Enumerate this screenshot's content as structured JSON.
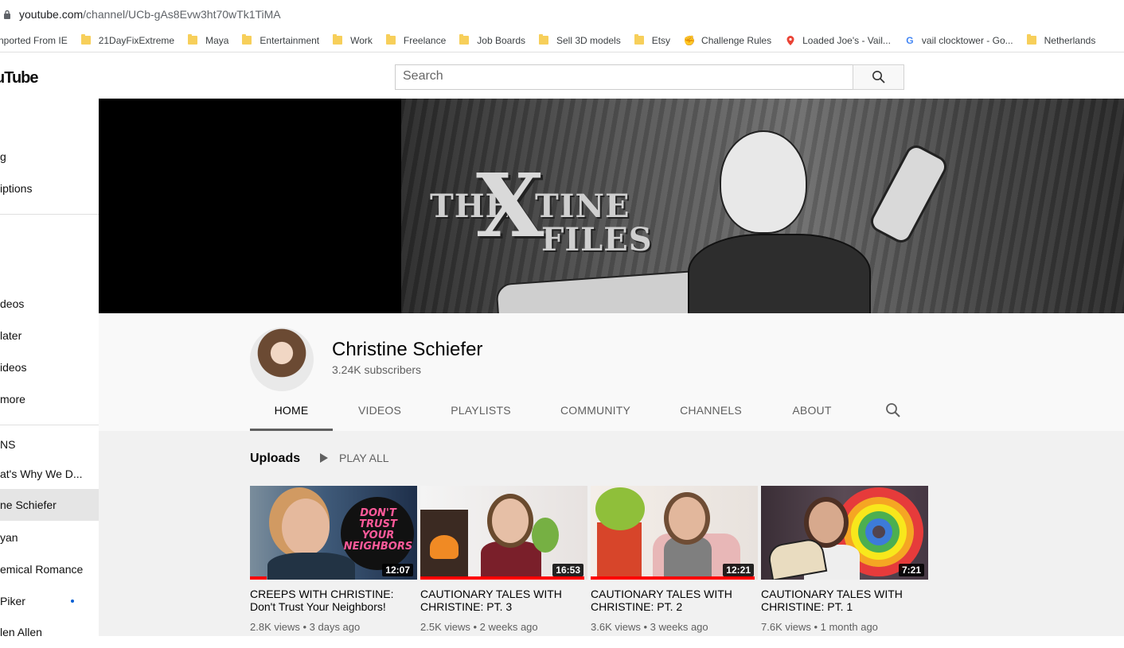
{
  "browser": {
    "url_host": "youtube.com",
    "url_path": "/channel/UCb-gAs8Evw3ht70wTk1TiMA",
    "bookmarks": [
      {
        "label": "nported From IE",
        "icon": "folder-icon"
      },
      {
        "label": "21DayFixExtreme",
        "icon": "folder-icon"
      },
      {
        "label": "Maya",
        "icon": "folder-icon"
      },
      {
        "label": "Entertainment",
        "icon": "folder-icon"
      },
      {
        "label": "Work",
        "icon": "folder-icon"
      },
      {
        "label": "Freelance",
        "icon": "folder-icon"
      },
      {
        "label": "Job Boards",
        "icon": "folder-icon"
      },
      {
        "label": "Sell 3D models",
        "icon": "folder-icon"
      },
      {
        "label": "Etsy",
        "icon": "folder-icon"
      },
      {
        "label": "Challenge Rules",
        "icon": "challenge-icon"
      },
      {
        "label": "Loaded Joe's - Vail...",
        "icon": "map-pin-icon"
      },
      {
        "label": "vail clocktower - Go...",
        "icon": "google-icon"
      },
      {
        "label": "Netherlands",
        "icon": "folder-icon"
      }
    ]
  },
  "masthead": {
    "logo": "uTube",
    "search_placeholder": "Search"
  },
  "sidebar": {
    "items": [
      {
        "label": "g"
      },
      {
        "label": "iptions"
      },
      {
        "label": "deos"
      },
      {
        "label": "later"
      },
      {
        "label": "ideos"
      },
      {
        "label": "more"
      },
      {
        "label": "NS"
      },
      {
        "label": "at's Why We D..."
      },
      {
        "label": "ne Schiefer"
      },
      {
        "label": "yan"
      },
      {
        "label": "emical Romance"
      },
      {
        "label": "Piker"
      },
      {
        "label": "len Allen"
      }
    ]
  },
  "channel": {
    "name": "Christine Schiefer",
    "subscribers": "3.24K subscribers",
    "tabs": [
      "HOME",
      "VIDEOS",
      "PLAYLISTS",
      "COMMUNITY",
      "CHANNELS",
      "ABOUT"
    ],
    "active_tab": "HOME"
  },
  "banner": {
    "title_the": "THE",
    "title_x": "X",
    "title_tine": "TINE",
    "title_files": "FILES"
  },
  "uploads": {
    "heading": "Uploads",
    "play_all": "PLAY ALL",
    "videos": [
      {
        "title": "CREEPS WITH CHRISTINE: Don't Trust Your Neighbors!",
        "meta": "2.8K views • 3 days ago",
        "duration": "12:07",
        "thumb_text": "DON'T TRUST YOUR NEIGHBORS",
        "watched": 0.1
      },
      {
        "title": "CAUTIONARY TALES WITH CHRISTINE: PT. 3",
        "meta": "2.5K views • 2 weeks ago",
        "duration": "16:53",
        "watched": 0.98
      },
      {
        "title": "CAUTIONARY TALES WITH CHRISTINE: PT. 2",
        "meta": "3.6K views • 3 weeks ago",
        "duration": "12:21",
        "watched": 0.98
      },
      {
        "title": "CAUTIONARY TALES WITH CHRISTINE: PT. 1",
        "meta": "7.6K views • 1 month ago",
        "duration": "7:21",
        "watched": 0
      }
    ]
  },
  "colors": {
    "accent_red": "#ff0000",
    "folder": "#f7cf5a",
    "link_blue": "#065fd4"
  }
}
